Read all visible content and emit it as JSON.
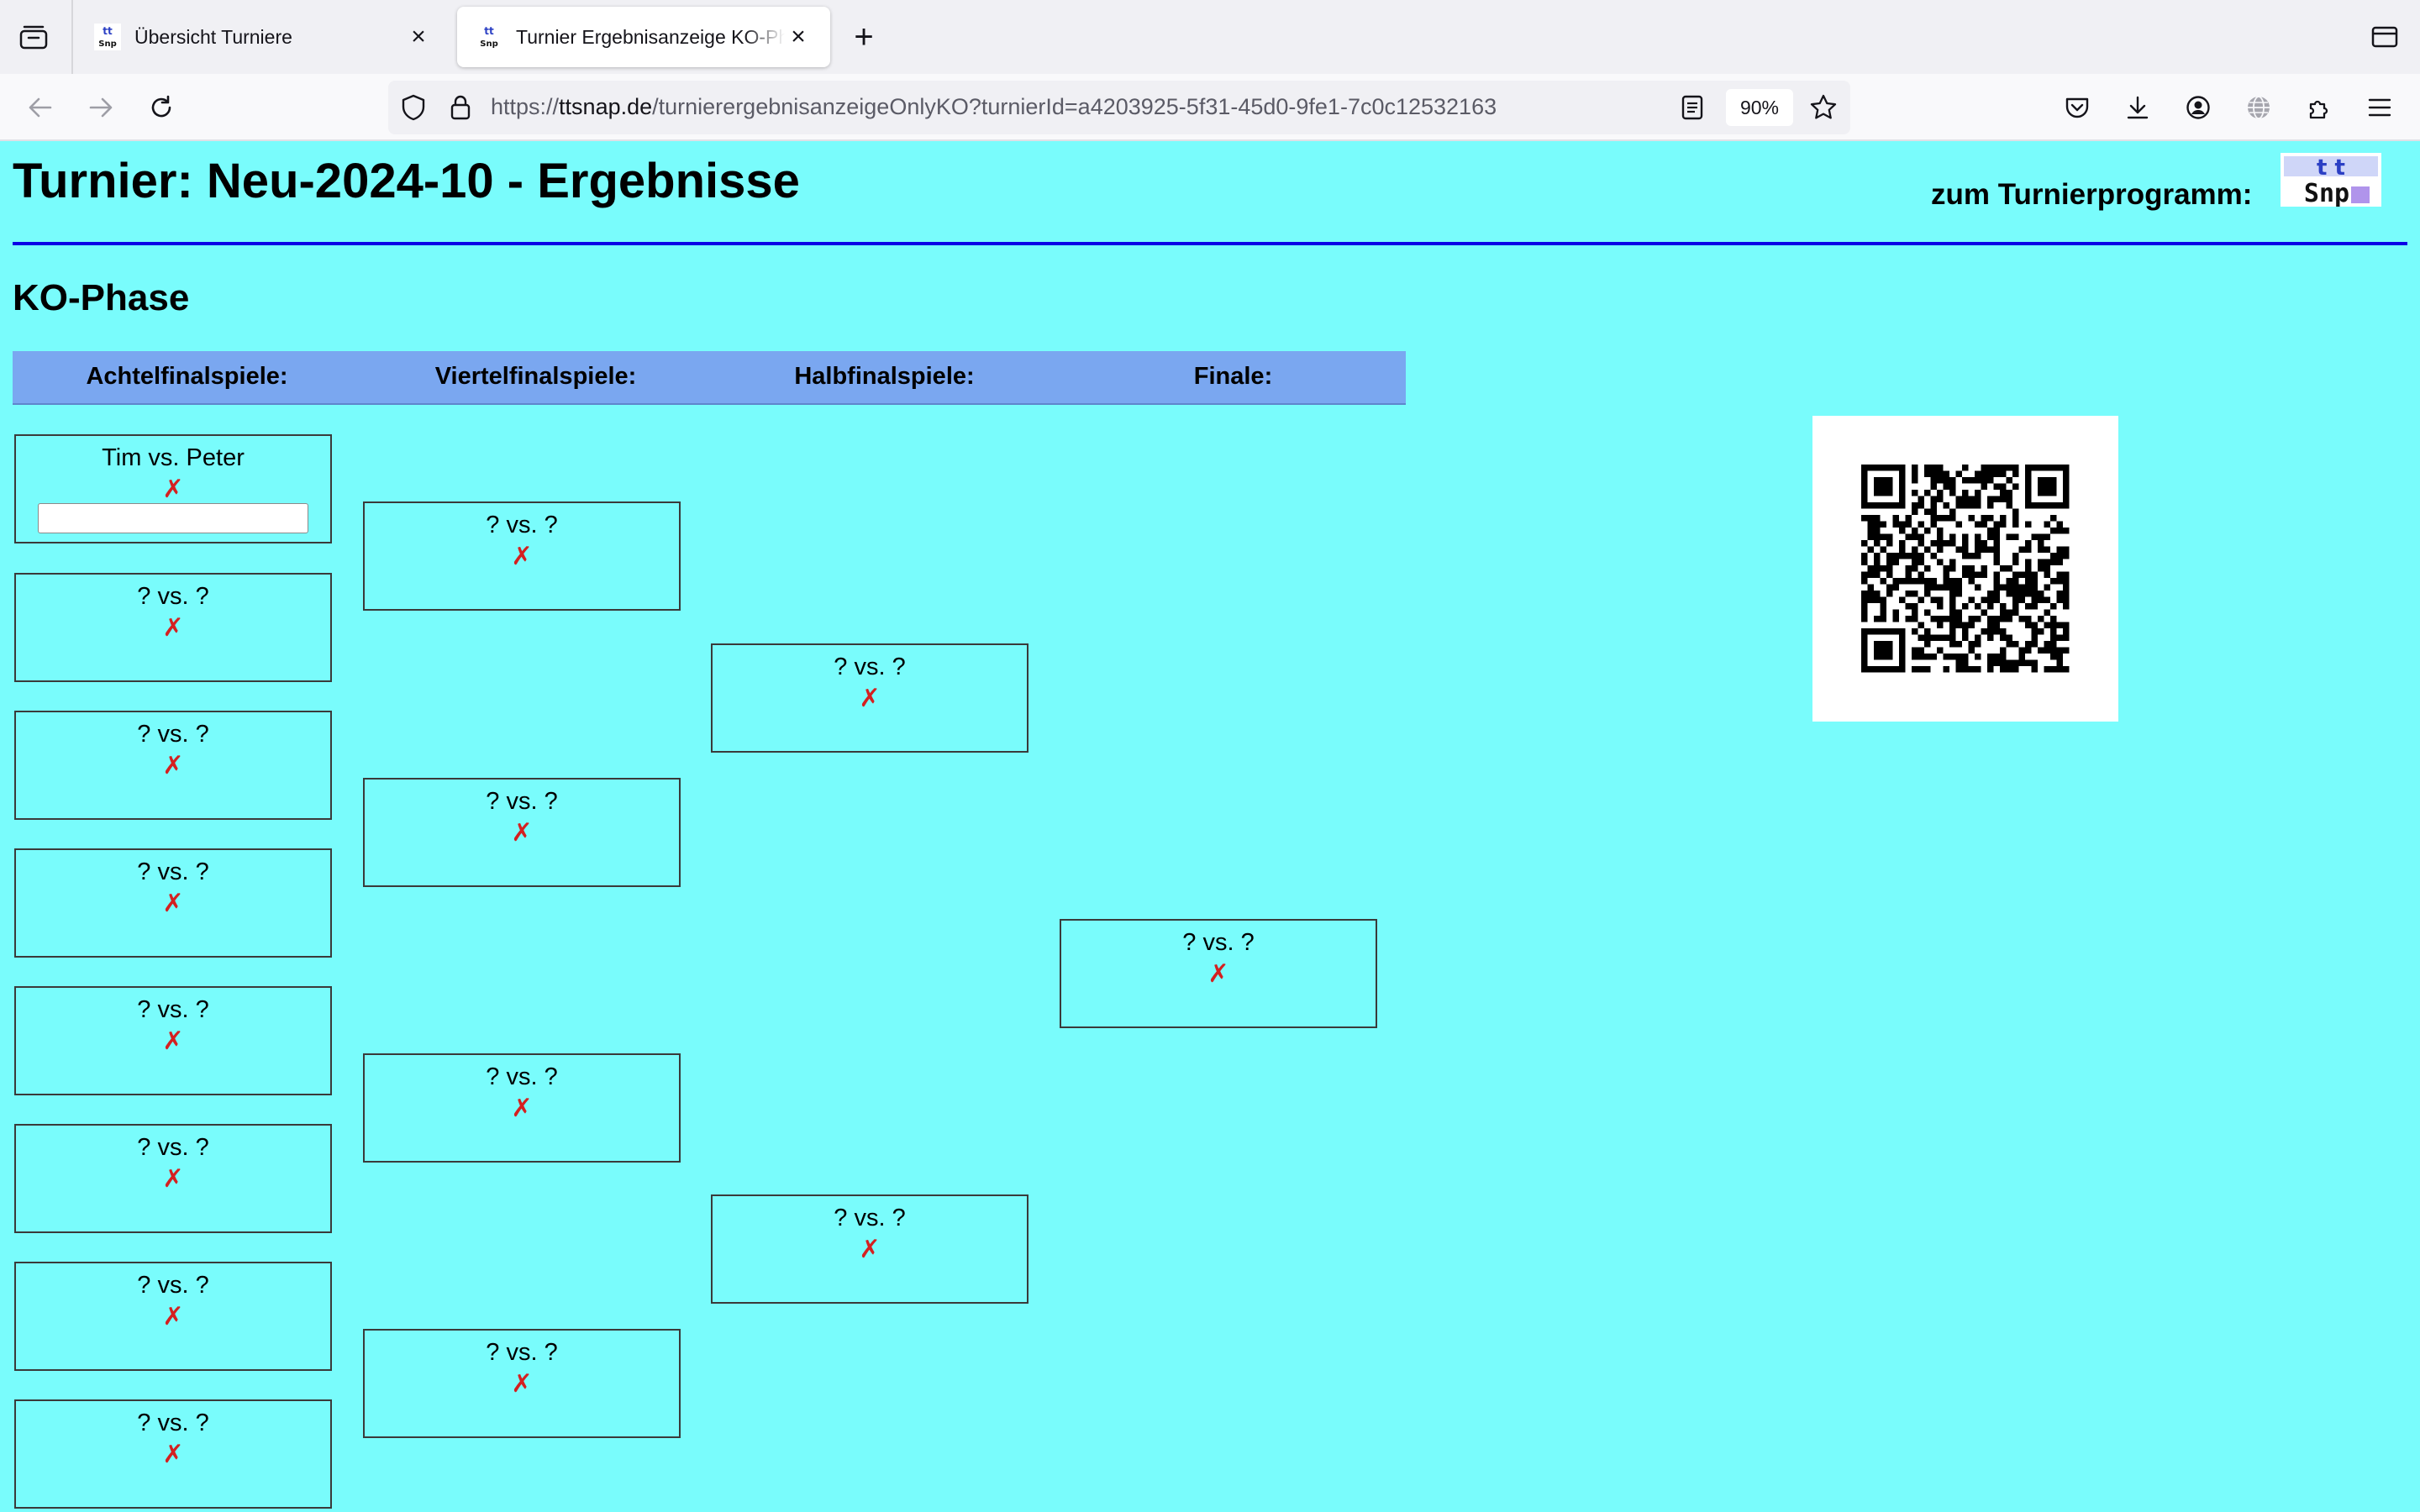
{
  "browser": {
    "tabs": [
      {
        "title": "Übersicht Turniere",
        "active": false
      },
      {
        "title": "Turnier Ergebnisanzeige KO-Phase",
        "active": true
      }
    ],
    "url_prefix": "https://",
    "url_host": "ttsnap.de",
    "url_path": "/turnierergebnisanzeigeOnlyKO?turnierId=a4203925-5f31-45d0-9fe1-7c0c12532163",
    "zoom": "90%",
    "icons": [
      "tab-list-icon",
      "close-icon",
      "plus-icon",
      "back-arrow-icon",
      "forward-arrow-icon",
      "reload-icon",
      "shield-icon",
      "lock-icon",
      "reader-view-icon",
      "star-icon",
      "pocket-icon",
      "download-icon",
      "account-icon",
      "vpn-globe-icon",
      "extensions-icon",
      "menu-icon",
      "list-all-tabs-icon"
    ]
  },
  "page": {
    "title": "Turnier: Neu-2024-10 - Ergebnisse",
    "program_link": "zum Turnierprogramm:",
    "logo_text": "tt Snap",
    "section_title": "KO-Phase",
    "accent_color": "#0a00e6",
    "background_color": "#79fcfc"
  },
  "bracket": {
    "rounds": [
      {
        "label": "Achtelfinalspiele:",
        "matches": [
          {
            "title": "Tim vs. Peter",
            "mark": "✗",
            "has_input": true,
            "input_value": ""
          },
          {
            "title": "? vs. ?",
            "mark": "✗"
          },
          {
            "title": "? vs. ?",
            "mark": "✗"
          },
          {
            "title": "? vs. ?",
            "mark": "✗"
          },
          {
            "title": "? vs. ?",
            "mark": "✗"
          },
          {
            "title": "? vs. ?",
            "mark": "✗"
          },
          {
            "title": "? vs. ?",
            "mark": "✗"
          },
          {
            "title": "? vs. ?",
            "mark": "✗"
          }
        ]
      },
      {
        "label": "Viertelfinalspiele:",
        "matches": [
          {
            "title": "? vs. ?",
            "mark": "✗"
          },
          {
            "title": "? vs. ?",
            "mark": "✗"
          },
          {
            "title": "? vs. ?",
            "mark": "✗"
          },
          {
            "title": "? vs. ?",
            "mark": "✗"
          }
        ]
      },
      {
        "label": "Halbfinalspiele:",
        "matches": [
          {
            "title": "? vs. ?",
            "mark": "✗"
          },
          {
            "title": "? vs. ?",
            "mark": "✗"
          }
        ]
      },
      {
        "label": "Finale:",
        "matches": [
          {
            "title": "? vs. ?",
            "mark": "✗"
          }
        ]
      }
    ]
  }
}
